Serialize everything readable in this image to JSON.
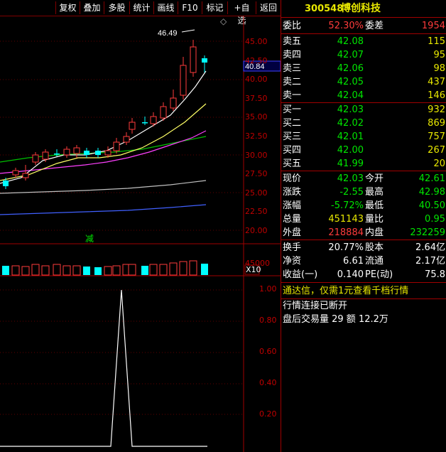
{
  "toolbar": {
    "buttons": [
      "复权",
      "叠加",
      "多股",
      "统计",
      "画线",
      "F10",
      "标记",
      "+自选",
      "返回"
    ]
  },
  "chart": {
    "peak_label": "46.49",
    "current_price_tag": "40.84",
    "price_ticks": [
      "45.00",
      "42.50",
      "40.00",
      "37.50",
      "35.00",
      "32.50",
      "30.00",
      "27.50",
      "25.00",
      "22.50",
      "20.00"
    ],
    "volume_tick": "45000",
    "volume_unit": "X10",
    "reduce_marker": "减",
    "indicator_ticks": [
      "1.00",
      "0.80",
      "0.60",
      "0.40",
      "0.20"
    ],
    "colors": {
      "up": "#ff3b3b",
      "down": "#00ffff",
      "ma5": "#ffffff",
      "ma10": "#ffff66",
      "ma20": "#ff40ff",
      "ma30": "#00c000",
      "ma60": "#c0c0c0",
      "ma120": "#4060ff",
      "grid": "#a00000"
    }
  },
  "quote": {
    "code": "300548",
    "name": "博创科技",
    "weibi_label": "委比",
    "weibi": "52.30%",
    "weicha_label": "委差",
    "weicha": "1954",
    "asks": [
      {
        "label": "卖五",
        "price": "42.08",
        "vol": "115"
      },
      {
        "label": "卖四",
        "price": "42.07",
        "vol": "95"
      },
      {
        "label": "卖三",
        "price": "42.06",
        "vol": "98"
      },
      {
        "label": "卖二",
        "price": "42.05",
        "vol": "437"
      },
      {
        "label": "卖一",
        "price": "42.04",
        "vol": "146"
      }
    ],
    "bids": [
      {
        "label": "买一",
        "price": "42.03",
        "vol": "932"
      },
      {
        "label": "买二",
        "price": "42.02",
        "vol": "869"
      },
      {
        "label": "买三",
        "price": "42.01",
        "vol": "757"
      },
      {
        "label": "买四",
        "price": "42.00",
        "vol": "267"
      },
      {
        "label": "买五",
        "price": "41.99",
        "vol": "20"
      }
    ],
    "stats": [
      {
        "l1": "现价",
        "v1": "42.03",
        "c1": "green",
        "l2": "今开",
        "v2": "42.61",
        "c2": "green"
      },
      {
        "l1": "涨跌",
        "v1": "-2.55",
        "c1": "green",
        "l2": "最高",
        "v2": "42.98",
        "c2": "green"
      },
      {
        "l1": "涨幅",
        "v1": "-5.72%",
        "c1": "green",
        "l2": "最低",
        "v2": "40.50",
        "c2": "green"
      },
      {
        "l1": "总量",
        "v1": "451143",
        "c1": "yellow",
        "l2": "量比",
        "v2": "0.95",
        "c2": "green"
      },
      {
        "l1": "外盘",
        "v1": "218884",
        "c1": "red",
        "l2": "内盘",
        "v2": "232259",
        "c2": "green"
      }
    ],
    "stats2": [
      {
        "l1": "换手",
        "v1": "20.77%",
        "l2": "股本",
        "v2": "2.64亿"
      },
      {
        "l1": "净资",
        "v1": "6.61",
        "l2": "流通",
        "v2": "2.17亿"
      },
      {
        "l1": "收益(一)",
        "v1": "0.140",
        "l2": "PE(动)",
        "v2": "75.8"
      }
    ],
    "notice": "通达信，仅需1元查看千档行情",
    "status": "行情连接已断开",
    "after_hours": "盘后交易量 29 额 12.2万"
  }
}
